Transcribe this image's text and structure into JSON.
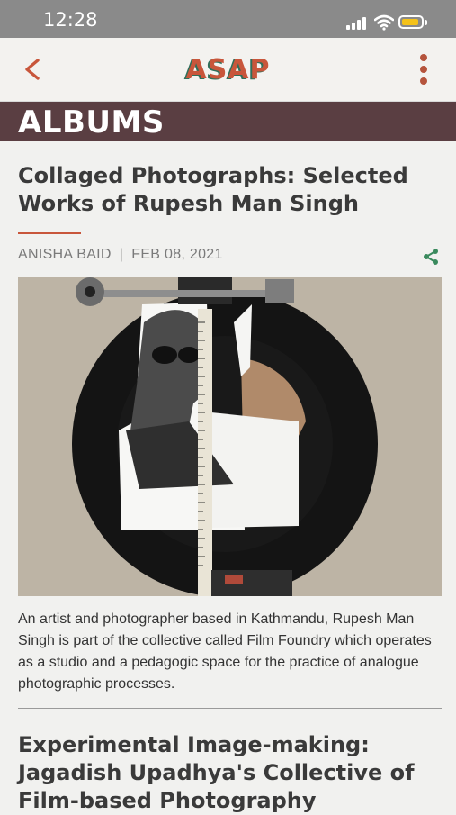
{
  "status_bar": {
    "time": "12:28",
    "battery_color": "#f4c21a"
  },
  "header": {
    "logo": "ASAP",
    "back_icon": "chevron-left-icon",
    "menu_icon": "more-vertical-icon",
    "accent_color": "#c8563b"
  },
  "section": {
    "title": "ALBUMS",
    "bar_color": "#5a3e42"
  },
  "articles": [
    {
      "title": "Collaged Photographs:  Selected Works of Rupesh Man Singh",
      "author": "ANISHA BAID",
      "separator": "|",
      "date": "FEB 08, 2021",
      "share_icon": "share-icon",
      "excerpt": "An artist and photographer based in Kathmandu, Rupesh Man Singh is part of the collective called Film Foundry which operates as a studio and a pedagogic space for the practice of analogue photographic processes."
    },
    {
      "title": "Experimental Image-making: Jagadish Upadhya's Collective of Film-based Photography"
    }
  ]
}
